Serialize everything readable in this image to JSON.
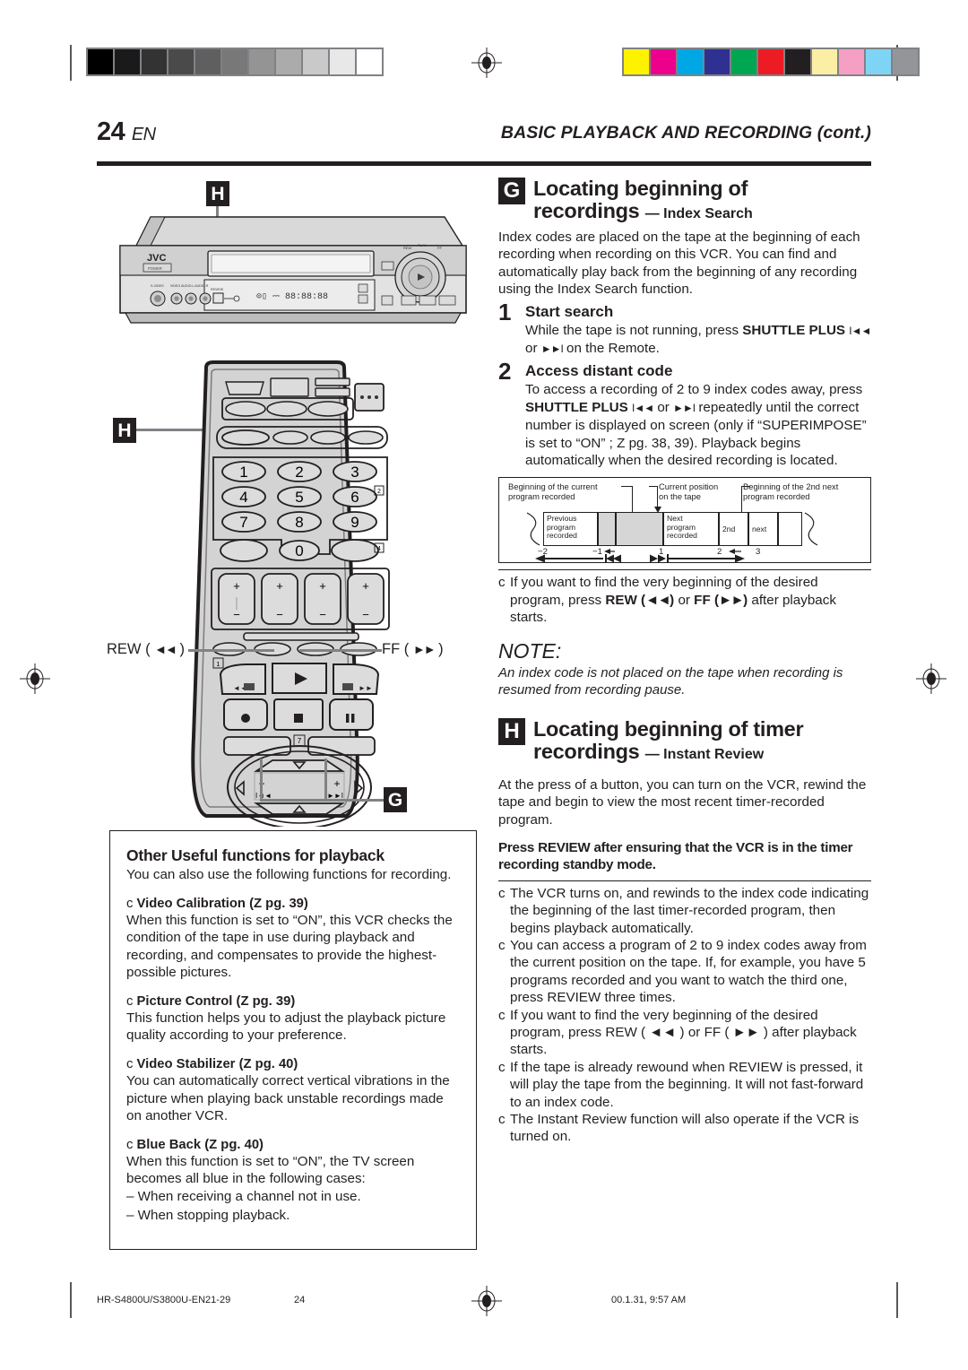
{
  "header": {
    "page_number": "24",
    "page_lang": "EN",
    "title": "BASIC PLAYBACK AND RECORDING (cont.)"
  },
  "figure": {
    "vcr_callout": "H",
    "vcr_brand": "JVC",
    "vcr_power_label": "POWER",
    "remote_callout_h": "H",
    "remote_callout_g": "G",
    "rew_label": "REW (",
    "rew_arrow": "◄◄",
    "rew_label_end": ")",
    "ff_label": "FF (",
    "ff_arrow": "►►",
    "ff_label_end": ")",
    "keypad": [
      "1",
      "2",
      "3",
      "4",
      "5",
      "6",
      "7",
      "8",
      "9",
      "0"
    ],
    "badge_2": "2",
    "badge_4": "4",
    "badge_1": "1",
    "badge_7": "7"
  },
  "section_g": {
    "letter": "G",
    "title_line1": "Locating beginning of",
    "title_line2": "recordings",
    "subtitle": "— Index Search",
    "intro": "Index codes are placed on the tape at the beginning of each recording when recording on this VCR. You can find and automatically play back from the beginning of any recording using the Index Search function.",
    "steps": [
      {
        "num": "1",
        "title": "Start search",
        "body_pre": "While the tape is not running, press ",
        "body_bold": "SHUTTLE PLUS",
        "body_post": " ",
        "arrow_rew": "I◄◄",
        "body_mid": " or ",
        "arrow_ff": "►►I",
        "body_end": " on the Remote."
      },
      {
        "num": "2",
        "title": "Access distant code",
        "body_pre": "To access a recording of 2 to 9 index codes away, press ",
        "body_bold": "SHUTTLE PLUS",
        "arrow_rew": "I◄◄",
        "body_mid": " or ",
        "arrow_ff": "►►I",
        "body_end": " repeatedly until the correct number is displayed on screen (only if “SUPERIMPOSE” is set to “ON” ; Z pg. 38, 39). Playback begins automatically when the desired recording is located."
      }
    ],
    "bullet": {
      "marker": "c",
      "pre": "If you want to find the very beginning of the desired program, press ",
      "rew_bold": "REW (",
      "rew_arrow": "◄◄",
      "rew_close": ")",
      "mid": " or ",
      "ff_bold": "FF (",
      "ff_arrow": "►►",
      "ff_close": ")",
      "post": " after playback starts."
    },
    "note_heading": "NOTE:",
    "note_body": "An index code is not placed on the tape when recording is resumed from recording pause."
  },
  "diagram": {
    "label_left_1": "Beginning of the current",
    "label_left_2": "program recorded",
    "label_mid_1": "Current position",
    "label_mid_2": "on the tape",
    "label_right_1": "Beginning of the 2nd next",
    "label_right_2": "program recorded",
    "segments": [
      {
        "lines": [
          "Previous",
          "program",
          "recorded"
        ],
        "shaded": false
      },
      {
        "lines": [],
        "shaded": true
      },
      {
        "lines": [],
        "shaded": true
      },
      {
        "lines": [
          "Next",
          "program",
          "recorded"
        ],
        "shaded": false
      },
      {
        "lines": [
          "2nd"
        ],
        "shaded": false
      },
      {
        "lines": [
          "next"
        ],
        "shaded": false
      }
    ],
    "ticks": [
      "−2",
      "−1",
      "1",
      "2",
      "3"
    ],
    "arrow_rew": "I◄◄",
    "arrow_ff": "►►I"
  },
  "section_h": {
    "letter": "H",
    "title_line1": "Locating beginning of timer",
    "title_line2": "recordings",
    "subtitle": "— Instant Review",
    "intro": "At the press of a button, you can turn on the VCR, rewind the tape and begin to view the most recent timer-recorded program.",
    "instruction": "Press REVIEW after ensuring that the VCR is in the timer recording standby mode.",
    "bullets": [
      {
        "marker": "c",
        "text": "The VCR turns on, and rewinds to the index code indicating the beginning of the last timer-recorded program, then begins playback automatically."
      },
      {
        "marker": "c",
        "text": "You can access a program of 2 to 9 index codes away from the current position on the tape. If, for example, you have 5 programs recorded and you want to watch the third one, press REVIEW three times."
      },
      {
        "marker": "c",
        "text": "If you want to find the very beginning of the desired program, press REW ( ◄◄ ) or FF ( ►► ) after playback starts."
      },
      {
        "marker": "c",
        "text": "If the tape is already rewound when REVIEW is pressed, it will play the tape from the beginning. It will not fast-forward to an index code."
      },
      {
        "marker": "c",
        "text": "The Instant Review function will also operate if the VCR is turned on."
      }
    ]
  },
  "usebox": {
    "heading": "Other Useful functions for playback",
    "intro": "You can also use the following functions for recording.",
    "items": [
      {
        "marker": "c",
        "title": "Video Calibration",
        "ref": "(Z pg. 39)",
        "body": "When this function is set to “ON”, this VCR checks the condition of the tape in use during playback and recording, and compensates to provide the highest-possible pictures."
      },
      {
        "marker": "c",
        "title": "Picture Control",
        "ref": "(Z pg. 39)",
        "body": "This function helps you to adjust the playback picture quality according to your preference."
      },
      {
        "marker": "c",
        "title": "Video Stabilizer",
        "ref": "(Z pg. 40)",
        "body": "You can automatically correct vertical vibrations in the picture when playing back unstable recordings made on another VCR."
      },
      {
        "marker": "c",
        "title": "Blue Back",
        "ref": "(Z pg. 40)",
        "body": "When this function is set to “ON”, the TV screen becomes all blue in the following cases:",
        "sublines": [
          "– When receiving a channel not in use.",
          "– When stopping playback."
        ]
      }
    ]
  },
  "footer": {
    "file_id": "HR-S4800U/S3800U-EN21-29",
    "page": "24",
    "timestamp": "00.1.31, 9:57 AM"
  },
  "printbars": {
    "grayscale": [
      "#000000",
      "#1a1a1a",
      "#333333",
      "#4a4a4a",
      "#5f5f5f",
      "#787878",
      "#949494",
      "#ababab",
      "#c9c9c9",
      "#e8e8e8",
      "#ffffff"
    ],
    "color": [
      "#fff200",
      "#ec008c",
      "#00a7e5",
      "#2e3192",
      "#00a651",
      "#ed1c24",
      "#231f20",
      "#fbefa5",
      "#f59fc4",
      "#7fd4f5",
      "#939598"
    ]
  }
}
